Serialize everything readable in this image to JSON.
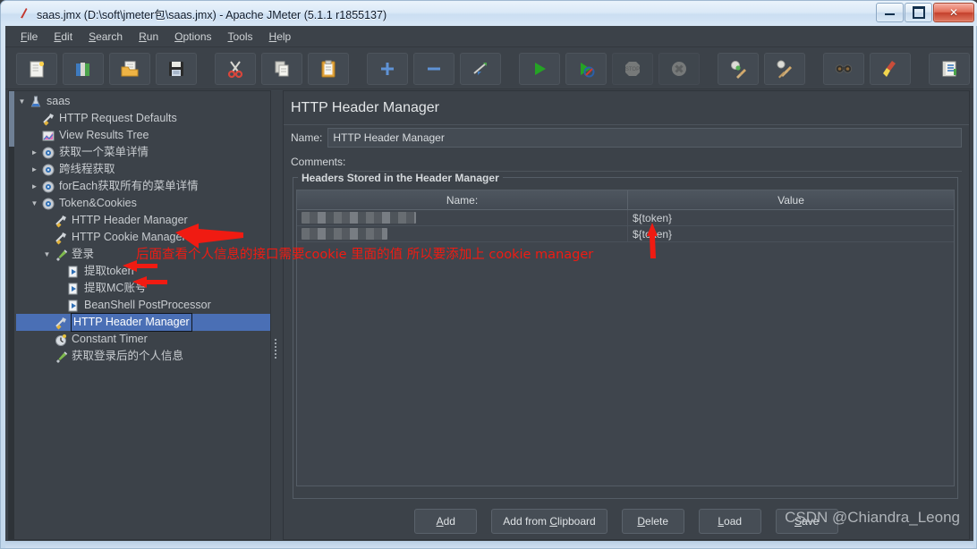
{
  "window": {
    "title": "saas.jmx (D:\\soft\\jmeter包\\saas.jmx) - Apache JMeter (5.1.1 r1855137)",
    "app_icon": "jmeter-feather-icon",
    "minimize_label": "–",
    "maximize_label": "□",
    "close_label": "✕"
  },
  "menubar": {
    "items": [
      {
        "label": "File",
        "mnemonic": "F"
      },
      {
        "label": "Edit",
        "mnemonic": "E"
      },
      {
        "label": "Search",
        "mnemonic": "S"
      },
      {
        "label": "Run",
        "mnemonic": "R"
      },
      {
        "label": "Options",
        "mnemonic": "O"
      },
      {
        "label": "Tools",
        "mnemonic": "T"
      },
      {
        "label": "Help",
        "mnemonic": "H"
      }
    ]
  },
  "toolbar": {
    "buttons": [
      {
        "name": "new-icon",
        "tip": "New"
      },
      {
        "name": "templates-icon",
        "tip": "Templates"
      },
      {
        "name": "open-icon",
        "tip": "Open"
      },
      {
        "name": "save-icon",
        "tip": "Save"
      },
      {
        "name": "cut-icon",
        "tip": "Cut"
      },
      {
        "name": "copy-icon",
        "tip": "Copy"
      },
      {
        "name": "paste-icon",
        "tip": "Paste"
      },
      {
        "name": "expand-all-icon",
        "tip": "Expand All"
      },
      {
        "name": "collapse-all-icon",
        "tip": "Collapse All"
      },
      {
        "name": "toggle-icon",
        "tip": "Toggle"
      },
      {
        "name": "start-icon",
        "tip": "Start"
      },
      {
        "name": "start-no-timers-icon",
        "tip": "Start no pauses"
      },
      {
        "name": "stop-icon",
        "tip": "Stop",
        "disabled": true
      },
      {
        "name": "shutdown-icon",
        "tip": "Shutdown",
        "disabled": true
      },
      {
        "name": "clear-icon",
        "tip": "Clear"
      },
      {
        "name": "clear-all-icon",
        "tip": "Clear All"
      },
      {
        "name": "search-icon",
        "tip": "Search"
      },
      {
        "name": "reset-search-icon",
        "tip": "Reset Search"
      },
      {
        "name": "function-helper-icon",
        "tip": "Function Helper Dialog"
      },
      {
        "name": "help-icon",
        "tip": "Help"
      }
    ]
  },
  "tree": {
    "nodes": [
      {
        "label": "saas",
        "icon": "test-plan-icon",
        "depth": 0,
        "toggle": "expanded",
        "selected": false
      },
      {
        "label": "HTTP Request Defaults",
        "icon": "config-element-icon",
        "depth": 1,
        "toggle": "none",
        "selected": false
      },
      {
        "label": "View Results Tree",
        "icon": "listener-icon",
        "depth": 1,
        "toggle": "none",
        "selected": false
      },
      {
        "label": "获取一个菜单详情",
        "icon": "thread-group-icon",
        "depth": 1,
        "toggle": "collapsed",
        "selected": false
      },
      {
        "label": "跨线程获取",
        "icon": "thread-group-icon",
        "depth": 1,
        "toggle": "collapsed",
        "selected": false
      },
      {
        "label": "forEach获取所有的菜单详情",
        "icon": "thread-group-icon",
        "depth": 1,
        "toggle": "collapsed",
        "selected": false
      },
      {
        "label": "Token&Cookies",
        "icon": "thread-group-icon",
        "depth": 1,
        "toggle": "expanded",
        "selected": false
      },
      {
        "label": "HTTP Header Manager",
        "icon": "config-element-icon",
        "depth": 2,
        "toggle": "none",
        "selected": false
      },
      {
        "label": "HTTP Cookie Manager",
        "icon": "config-element-icon",
        "depth": 2,
        "toggle": "none",
        "selected": false
      },
      {
        "label": "登录",
        "icon": "http-sampler-icon",
        "depth": 2,
        "toggle": "expanded",
        "selected": false
      },
      {
        "label": "提取token",
        "icon": "post-processor-icon",
        "depth": 3,
        "toggle": "none",
        "selected": false
      },
      {
        "label": "提取MC账号",
        "icon": "post-processor-icon",
        "depth": 3,
        "toggle": "none",
        "selected": false
      },
      {
        "label": "BeanShell PostProcessor",
        "icon": "post-processor-icon",
        "depth": 3,
        "toggle": "none",
        "selected": false
      },
      {
        "label": "HTTP Header Manager",
        "icon": "config-element-icon",
        "depth": 2,
        "toggle": "none",
        "selected": true
      },
      {
        "label": "Constant Timer",
        "icon": "timer-icon",
        "depth": 2,
        "toggle": "none",
        "selected": false
      },
      {
        "label": "获取登录后的个人信息",
        "icon": "http-sampler-icon",
        "depth": 2,
        "toggle": "none",
        "selected": false
      }
    ]
  },
  "panel": {
    "title": "HTTP Header Manager",
    "name_label": "Name:",
    "name_value": "HTTP Header Manager",
    "comments_label": "Comments:",
    "comments_value": "",
    "group_legend": "Headers Stored in the Header Manager",
    "table": {
      "columns": [
        "Name:",
        "Value"
      ],
      "rows": [
        {
          "name": "",
          "name_redacted": true,
          "name_redacted_width": 128,
          "value": "${token}"
        },
        {
          "name": "",
          "name_redacted": true,
          "name_redacted_width": 96,
          "value": "${token}"
        }
      ]
    },
    "buttons": [
      {
        "label": "Add",
        "mnemonic": "A"
      },
      {
        "label": "Add from Clipboard",
        "mnemonic": "C"
      },
      {
        "label": "Delete",
        "mnemonic": "D"
      },
      {
        "label": "Load",
        "mnemonic": "L"
      },
      {
        "label": "Save",
        "mnemonic": "S"
      }
    ]
  },
  "annotations": {
    "note": "后面查看个人信息的接口需要cookie 里面的值 所以要添加上 cookie manager",
    "arrows": [
      {
        "name": "arrow-to-cookie-manager",
        "target": "HTTP Cookie Manager"
      },
      {
        "name": "arrow-to-extract-token",
        "target": "提取token"
      },
      {
        "name": "arrow-to-extract-mc",
        "target": "提取MC账号"
      },
      {
        "name": "arrow-up-to-token-value",
        "target": "${token}"
      }
    ],
    "color": "#f01b12"
  },
  "watermark": {
    "text": "CSDN @Chiandra_Leong"
  }
}
